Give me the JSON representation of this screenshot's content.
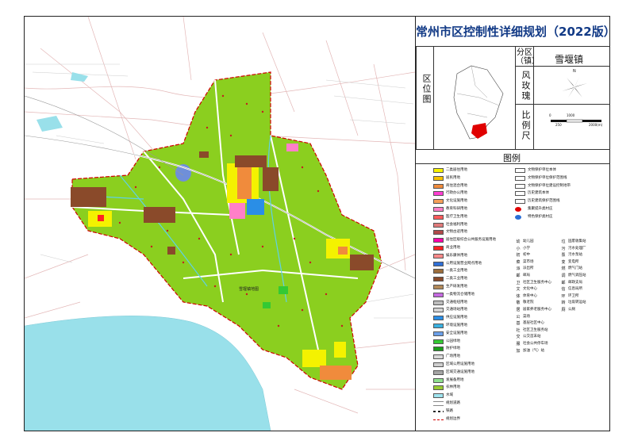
{
  "title": "常州市区控制性详细规划（2022版）",
  "district_label": "分区（镇）",
  "district_name": "雪堰镇",
  "location_map_label": "区位图",
  "wind_rose_label": "风玫瑰",
  "wind_north": "N",
  "scale_label": "比例尺",
  "scale_ticks": [
    "0",
    "1000",
    "250",
    "2000(m)"
  ],
  "legend_title": "图例",
  "map_text": "雪堰镇地图",
  "legend_landuse": [
    {
      "label": "二类居住用地",
      "color": "#f7f200"
    },
    {
      "label": "居民用地",
      "color": "#f4c200"
    },
    {
      "label": "商住混合用地",
      "color": "#f08b3c"
    },
    {
      "label": "行政办公用地",
      "color": "#ff3fd2"
    },
    {
      "label": "文化设施用地",
      "color": "#f5a05a"
    },
    {
      "label": "教育科研用地",
      "color": "#ff7fc8"
    },
    {
      "label": "医疗卫生用地",
      "color": "#ff5b5b"
    },
    {
      "label": "社会福利用地",
      "color": "#e07a7a"
    },
    {
      "label": "文物古迹用地",
      "color": "#b04a4a"
    },
    {
      "label": "居住区级综合公共服务设施用地",
      "color": "#ff00aa"
    },
    {
      "label": "商业用地",
      "color": "#ff2222"
    },
    {
      "label": "娱乐康体用地",
      "color": "#ff8a8a"
    },
    {
      "label": "公用设施营业网点用地",
      "color": "#2f6fd6"
    },
    {
      "label": "一类工业用地",
      "color": "#9b6d3c"
    },
    {
      "label": "二类工业用地",
      "color": "#8a4a2a"
    },
    {
      "label": "生产研发用地",
      "color": "#b38a5a"
    },
    {
      "label": "一类物流仓储用地",
      "color": "#c56ae0"
    },
    {
      "label": "交通枢纽用地",
      "color": "#bdbdbd"
    },
    {
      "label": "交通场站用地",
      "color": "#d4d4d4"
    },
    {
      "label": "供应设施用地",
      "color": "#2a8ee6"
    },
    {
      "label": "环境设施用地",
      "color": "#3bb0e0"
    },
    {
      "label": "安全设施用地",
      "color": "#6a9fe8"
    },
    {
      "label": "公园绿地",
      "color": "#34c934"
    },
    {
      "label": "防护绿地",
      "color": "#1a9e1a"
    },
    {
      "label": "广场用地",
      "color": "#d9d9d9"
    },
    {
      "label": "区域公用设施用地",
      "color": "#cfcfcf"
    },
    {
      "label": "区域交通设施用地",
      "color": "#a5a5a5"
    },
    {
      "label": "发展备用地",
      "color": "#8fe08f"
    },
    {
      "label": "农林用地",
      "color": "#99cc33"
    },
    {
      "label": "水域",
      "color": "#9fe3ee"
    },
    {
      "label": "规划道路",
      "color": "#ffffff"
    },
    {
      "label": "铁路",
      "color": "#ffffff"
    },
    {
      "label": "规划边界",
      "color": "#ffffff"
    }
  ],
  "legend_lines": [
    "文物保护单位本体",
    "文物保护单位保护范围线",
    "文物保护单位建设控制地带",
    "历史建筑本体",
    "历史建筑保护范围线",
    "集聚提升类村庄",
    "特色保护类村庄"
  ],
  "legend_symbols_left": [
    {
      "symbol": "幼",
      "label": "幼儿园"
    },
    {
      "symbol": "小",
      "label": "小学"
    },
    {
      "symbol": "初",
      "label": "初中"
    },
    {
      "symbol": "菜",
      "label": "菜市场"
    },
    {
      "symbol": "派",
      "label": "派出所"
    },
    {
      "symbol": "邮",
      "label": "邮局"
    },
    {
      "symbol": "卫",
      "label": "社区卫生服务中心"
    },
    {
      "symbol": "文",
      "label": "文化中心"
    },
    {
      "symbol": "体",
      "label": "体育中心"
    },
    {
      "symbol": "敬",
      "label": "敬老院"
    },
    {
      "symbol": "居",
      "label": "居家养老服务中心"
    },
    {
      "symbol": "公",
      "label": "菜场"
    },
    {
      "symbol": "基",
      "label": "基层社区中心"
    },
    {
      "symbol": "社",
      "label": "社区卫生服务站"
    },
    {
      "symbol": "交",
      "label": "公交首末站"
    },
    {
      "symbol": "服",
      "label": "社会公共停车场"
    },
    {
      "symbol": "加",
      "label": "加油（气）站"
    }
  ],
  "legend_symbols_right": [
    {
      "symbol": "垃",
      "label": "固废收集站"
    },
    {
      "symbol": "污",
      "label": "污水处理厂"
    },
    {
      "symbol": "泵",
      "label": "污水泵站"
    },
    {
      "symbol": "变",
      "label": "变电所"
    },
    {
      "symbol": "燃",
      "label": "燃气门站"
    },
    {
      "symbol": "调",
      "label": "燃气调压站"
    },
    {
      "symbol": "邮",
      "label": "邮政支局"
    },
    {
      "symbol": "信",
      "label": "信息局所"
    },
    {
      "symbol": "环",
      "label": "环卫所"
    },
    {
      "symbol": "转",
      "label": "垃圾转运站"
    },
    {
      "symbol": "厕",
      "label": "公厕"
    }
  ]
}
